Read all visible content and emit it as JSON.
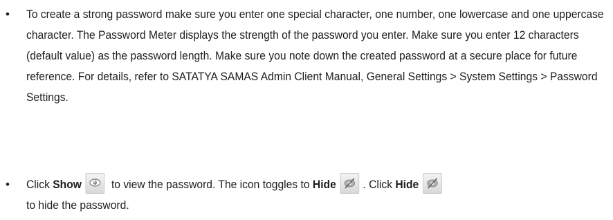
{
  "bullets": [
    {
      "marker": "•",
      "text": "To create a strong password make sure you enter one special character, one number, one lowercase and one uppercase character. The Password Meter displays the strength of the password you enter. Make sure you enter 12 characters (default value) as the password length. Make sure you note down the created password at a secure place for future reference. For details, refer to SATATYA SAMAS Admin Client Manual, General Settings > System Settings > Password Settings."
    },
    {
      "marker": "•",
      "part1": "Click ",
      "show_label": "Show",
      "part2": " to view the password. The icon toggles to ",
      "hide_label_1": "Hide",
      "part3": ". Click ",
      "hide_label_2": "Hide",
      "part4": " to hide the password.",
      "show_icon": "eye-icon",
      "hide_icon": "eye-slash-icon"
    }
  ]
}
